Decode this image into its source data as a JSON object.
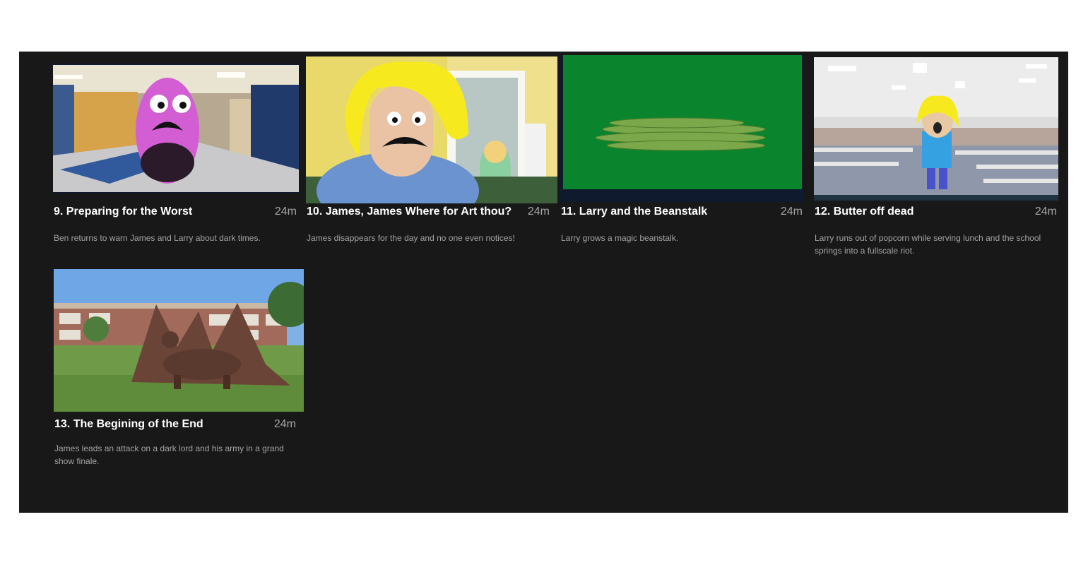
{
  "episodes": [
    {
      "title": "9. Preparing for the Worst",
      "duration": "24m",
      "description": "Ben returns to warn James and Larry about dark times.",
      "thumbnail": "purple-egg-character-in-school-hallway"
    },
    {
      "title": "10. James, James Where for Art thou?",
      "duration": "24m",
      "description": "James disappears for the day and no one even notices!",
      "thumbnail": "blonde-mustached-character-in-bedroom"
    },
    {
      "title": "11. Larry and the Beanstalk",
      "duration": "24m",
      "description": "Larry grows a magic beanstalk.",
      "thumbnail": "green-beans-on-green-screen"
    },
    {
      "title": "12. Butter off dead",
      "duration": "24m",
      "description": "Larry runs out of popcorn while serving lunch and the school springs into a fullscale riot.",
      "thumbnail": "blonde-character-in-cafeteria"
    },
    {
      "title": "13. The Begining of the End",
      "duration": "24m",
      "description": "James leads an attack on a dark lord and his army in a grand show finale.",
      "thumbnail": "dragon-on-school-lawn"
    }
  ],
  "colors": {
    "panel": "#181818",
    "title": "#ffffff",
    "duration": "#a6a6a6",
    "description": "#a3a3a3"
  }
}
